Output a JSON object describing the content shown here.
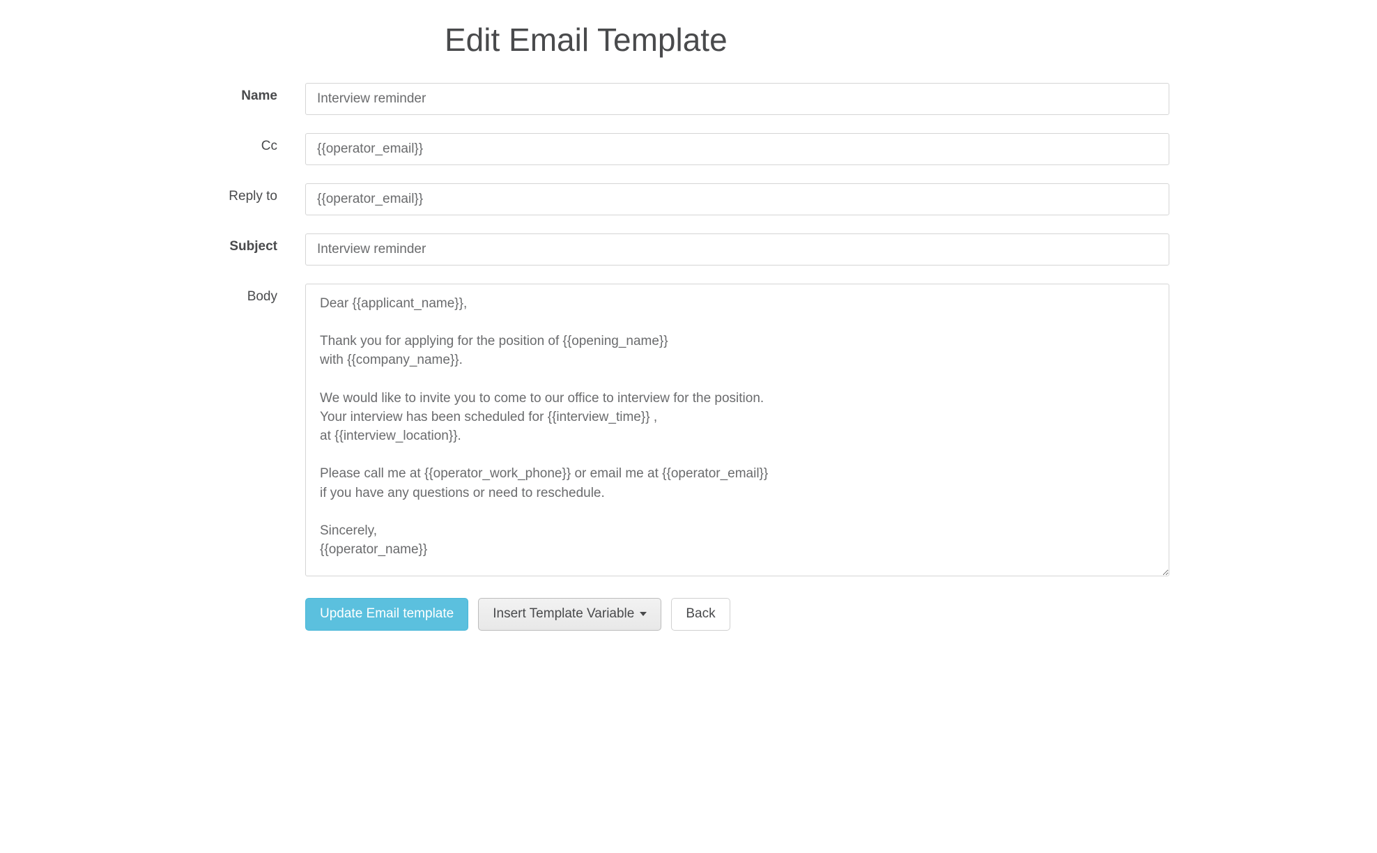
{
  "title": "Edit Email Template",
  "labels": {
    "name": "Name",
    "cc": "Cc",
    "reply_to": "Reply to",
    "subject": "Subject",
    "body": "Body"
  },
  "fields": {
    "name": "Interview reminder",
    "cc": "{{operator_email}}",
    "reply_to": "{{operator_email}}",
    "subject": "Interview reminder",
    "body": "Dear {{applicant_name}},\n\nThank you for applying for the position of {{opening_name}}\nwith {{company_name}}.\n\nWe would like to invite you to come to our office to interview for the position.\nYour interview has been scheduled for {{interview_time}} ,\nat {{interview_location}}.\n\nPlease call me at {{operator_work_phone}} or email me at {{operator_email}}\nif you have any questions or need to reschedule.\n\nSincerely,\n{{operator_name}}"
  },
  "buttons": {
    "update": "Update Email template",
    "insert_variable": "Insert Template Variable",
    "back": "Back"
  }
}
